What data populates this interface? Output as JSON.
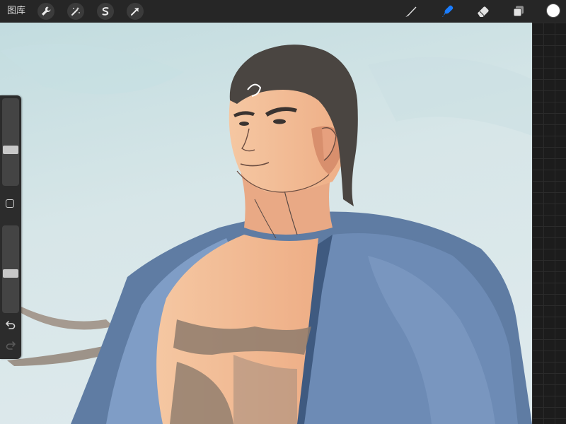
{
  "toolbar": {
    "gallery_label": "图库",
    "left_tools": [
      "wrench-icon",
      "magic-wand-icon",
      "selection-icon",
      "transform-arrow-icon"
    ],
    "right_tools": [
      "brush-icon",
      "smudge-icon",
      "eraser-icon",
      "layers-icon"
    ],
    "active_tool": "smudge-icon",
    "active_color": "#ffffff",
    "accent_color": "#1a7dff"
  },
  "sidebar": {
    "brush_size_level": 0.4,
    "opacity_level": 0.45,
    "controls": [
      "modify-button",
      "undo-icon",
      "redo-icon"
    ]
  },
  "canvas": {
    "sky_color": "#cfe2e4",
    "skin_color": "#f1b58f",
    "robe_color": "#6e8cb4",
    "hair_color": "#4a4541"
  }
}
